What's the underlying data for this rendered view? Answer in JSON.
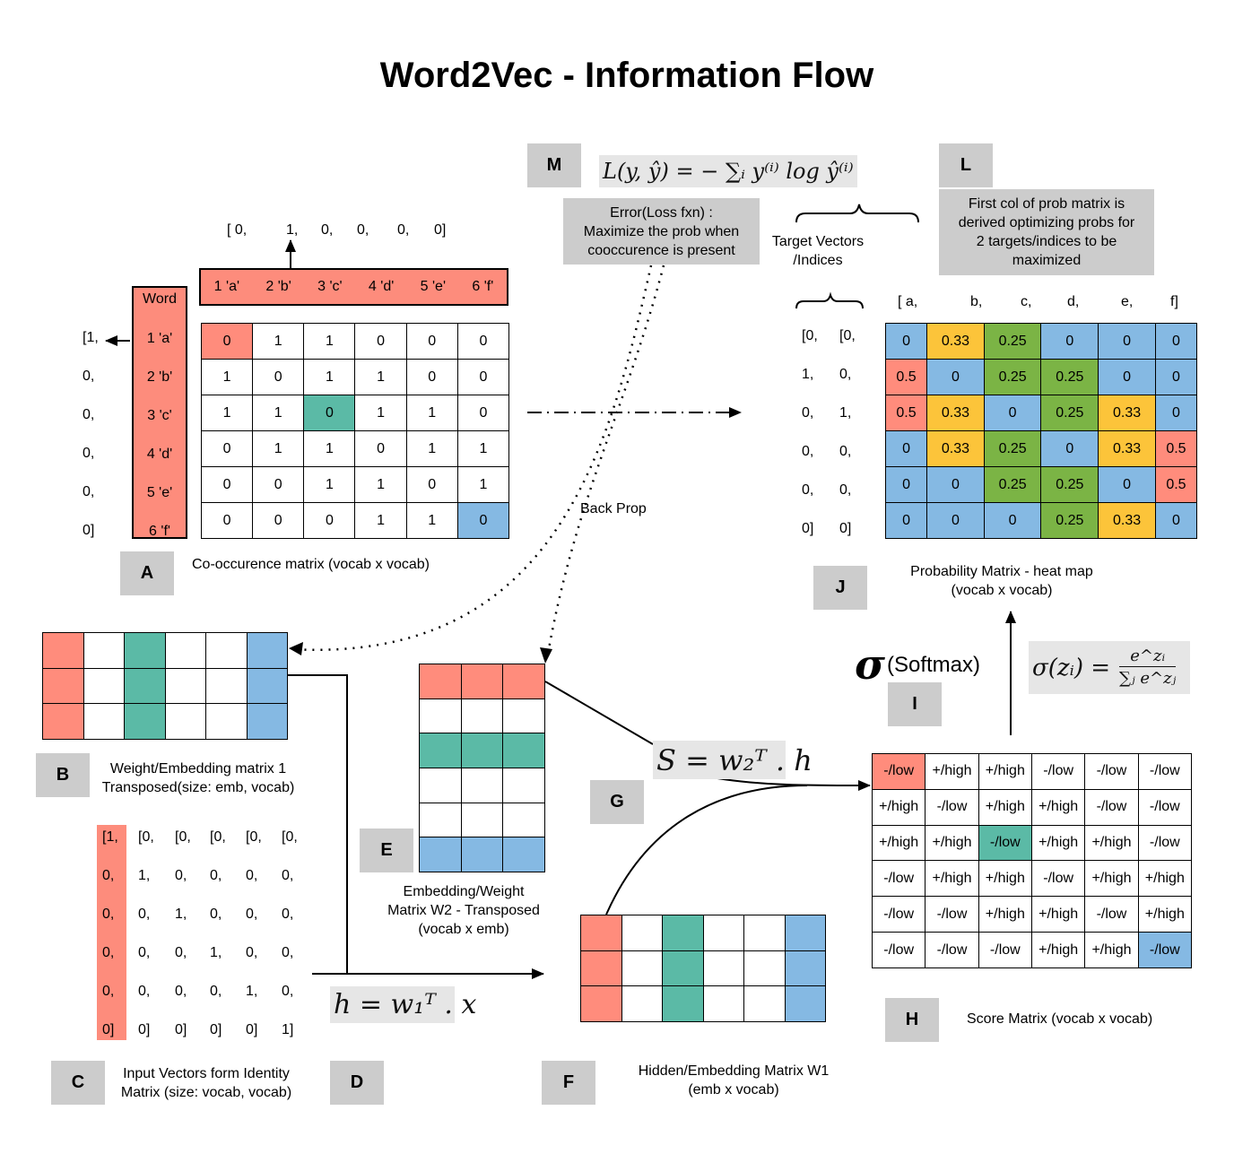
{
  "title": "Word2Vec - Information Flow",
  "colors": {
    "red": "#ff8c7c",
    "teal": "#5bbaa6",
    "blue": "#85b9e3",
    "yellow": "#fcc43a",
    "green": "#7bb445",
    "tag_gray": "#cccccc",
    "formula_gray": "#e6e6e6"
  },
  "tags": {
    "A": "A",
    "B": "B",
    "C": "C",
    "D": "D",
    "E": "E",
    "F": "F",
    "G": "G",
    "H": "H",
    "I": "I",
    "J": "J",
    "L": "L",
    "M": "M"
  },
  "cooccurrence": {
    "one_hot_top": [
      "[  0,",
      "1,",
      "0,",
      "0,",
      "0,",
      "0]"
    ],
    "vocab": [
      "1 'a'",
      "2 'b'",
      "3 'c'",
      "4 'd'",
      "5 'e'",
      "6 'f'"
    ],
    "word_header": "Word",
    "one_hot_left": [
      "[1,",
      "0,",
      "0,",
      "0,",
      "0,",
      "0]"
    ],
    "matrix": [
      [
        0,
        1,
        1,
        0,
        0,
        0
      ],
      [
        1,
        0,
        1,
        1,
        0,
        0
      ],
      [
        1,
        1,
        0,
        1,
        1,
        0
      ],
      [
        0,
        1,
        1,
        0,
        1,
        1
      ],
      [
        0,
        0,
        1,
        1,
        0,
        1
      ],
      [
        0,
        0,
        0,
        1,
        1,
        0
      ]
    ],
    "highlights": [
      [
        "0-0",
        "red"
      ],
      [
        "2-2",
        "teal"
      ],
      [
        "5-5",
        "blue"
      ]
    ],
    "caption": "Co-occurence matrix (vocab x vocab)"
  },
  "loss": {
    "formula": "L(y, ŷ) = − ∑ᵢ y⁽ⁱ⁾ log ŷ⁽ⁱ⁾",
    "note": [
      "Error(Loss fxn) :",
      "Maximize the prob when",
      "cooccurence is present"
    ],
    "back_prop_label": "Back Prop"
  },
  "targets": {
    "label": [
      "Target Vectors",
      "/Indices"
    ],
    "vector1": [
      "[0,",
      "1,",
      "0,",
      "0,",
      "0,",
      "0]"
    ],
    "vector2": [
      "[0,",
      "0,",
      "1,",
      "0,",
      "0,",
      "0]"
    ]
  },
  "note_L": [
    "First col of prob matrix is",
    "derived optimizing probs for",
    "2 targets/indices to be",
    "maximized"
  ],
  "prob_matrix": {
    "header": [
      "[  a,",
      "b,",
      "c,",
      "d,",
      "e,",
      "f]"
    ],
    "values": [
      [
        "0",
        "0.33",
        "0.25",
        "0",
        "0",
        "0"
      ],
      [
        "0.5",
        "0",
        "0.25",
        "0.25",
        "0",
        "0"
      ],
      [
        "0.5",
        "0.33",
        "0",
        "0.25",
        "0.33",
        "0"
      ],
      [
        "0",
        "0.33",
        "0.25",
        "0",
        "0.33",
        "0.5"
      ],
      [
        "0",
        "0",
        "0.25",
        "0.25",
        "0",
        "0.5"
      ],
      [
        "0",
        "0",
        "0",
        "0.25",
        "0.33",
        "0"
      ]
    ],
    "caption": [
      "Probability Matrix - heat map",
      "(vocab x vocab)"
    ]
  },
  "softmax": {
    "sigma": "σ",
    "label": "(Softmax)",
    "formula_lhs": "σ(zᵢ) =",
    "formula_num": "e^zᵢ",
    "formula_den": "∑ⱼ e^zⱼ"
  },
  "score_matrix": {
    "values": [
      [
        "-/low",
        "+/high",
        "+/high",
        "-/low",
        "-/low",
        "-/low"
      ],
      [
        "+/high",
        "-/low",
        "+/high",
        "+/high",
        "-/low",
        "-/low"
      ],
      [
        "+/high",
        "+/high",
        "-/low",
        "+/high",
        "+/high",
        "-/low"
      ],
      [
        "-/low",
        "+/high",
        "+/high",
        "-/low",
        "+/high",
        "+/high"
      ],
      [
        "-/low",
        "-/low",
        "+/high",
        "+/high",
        "-/low",
        "+/high"
      ],
      [
        "-/low",
        "-/low",
        "-/low",
        "+/high",
        "+/high",
        "-/low"
      ]
    ],
    "highlights": [
      [
        "0-0",
        "red"
      ],
      [
        "2-2",
        "teal"
      ],
      [
        "5-5",
        "blue"
      ]
    ],
    "caption": "Score Matrix (vocab x vocab)"
  },
  "w1t": {
    "caption": [
      "Weight/Embedding matrix 1",
      "Transposed(size: emb, vocab)"
    ],
    "rows": 3,
    "cols": 6,
    "col_colors": [
      "red",
      "white",
      "teal",
      "white",
      "white",
      "blue"
    ]
  },
  "identity": {
    "rows": [
      [
        "[1,",
        "[0,",
        "[0,",
        "[0,",
        "[0,",
        "[0,"
      ],
      [
        "0,",
        "1,",
        "0,",
        "0,",
        "0,",
        "0,"
      ],
      [
        "0,",
        "0,",
        "1,",
        "0,",
        "0,",
        "0,"
      ],
      [
        "0,",
        "0,",
        "0,",
        "1,",
        "0,",
        "0,"
      ],
      [
        "0,",
        "0,",
        "0,",
        "0,",
        "1,",
        "0,"
      ],
      [
        "0]",
        "0]",
        "0]",
        "0]",
        "0]",
        "1]"
      ]
    ],
    "caption": [
      "Input Vectors form Identity",
      "Matrix (size: vocab, vocab)"
    ]
  },
  "hidden_formula": "h = w₁ᵀ . x",
  "w2t": {
    "caption": [
      "Embedding/Weight",
      "Matrix W2 - Transposed",
      "(vocab x emb)"
    ],
    "rows": 6,
    "cols": 3,
    "row_colors": [
      "red",
      "white",
      "teal",
      "white",
      "white",
      "blue"
    ]
  },
  "score_formula": "S = w₂ᵀ . h",
  "w1": {
    "caption": [
      "Hidden/Embedding Matrix W1",
      "(emb x vocab)"
    ],
    "rows": 3,
    "cols": 6,
    "col_colors": [
      "red",
      "white",
      "teal",
      "white",
      "white",
      "blue"
    ]
  }
}
